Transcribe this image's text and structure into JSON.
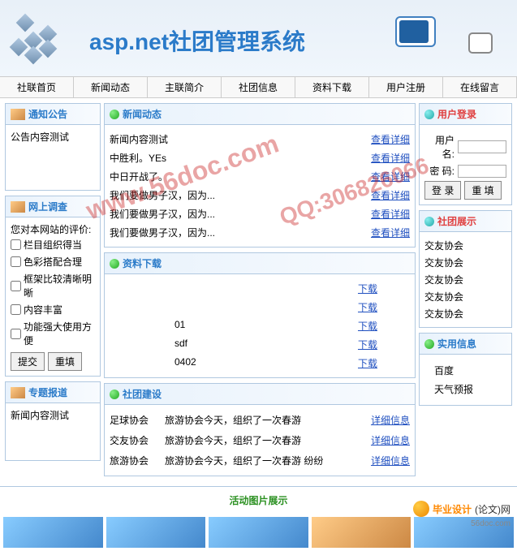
{
  "header": {
    "title": "asp.net社团管理系统"
  },
  "nav": [
    "社联首页",
    "新闻动态",
    "主联简介",
    "社团信息",
    "资料下载",
    "用户注册",
    "在线留言"
  ],
  "left": {
    "notice": {
      "title": "通知公告",
      "content": "公告内容测试"
    },
    "survey": {
      "title": "网上调查",
      "question": "您对本网站的评价:",
      "options": [
        "栏目组织得当",
        "色彩搭配合理",
        "框架比较清晰明晰",
        "内容丰富",
        "功能强大使用方便"
      ],
      "submit": "提交",
      "reset": "重填"
    },
    "special": {
      "title": "专题报道",
      "content": "新闻内容测试"
    }
  },
  "mid": {
    "news": {
      "title": "新闻动态",
      "items": [
        {
          "t": "新闻内容测试",
          "a": "查看详细"
        },
        {
          "t": "中胜利。YEs",
          "a": "查看详细"
        },
        {
          "t": "中日开战了。",
          "a": "查看详细"
        },
        {
          "t": "我们要做男子汉，因为...",
          "a": "查看详细"
        },
        {
          "t": "我们要做男子汉，因为...",
          "a": "查看详细"
        },
        {
          "t": "我们要做男子汉，因为...",
          "a": "查看详细"
        }
      ]
    },
    "download": {
      "title": "资料下载",
      "items": [
        {
          "t": "",
          "a": "下载"
        },
        {
          "t": "",
          "a": "下载"
        },
        {
          "t": "01",
          "a": "下载"
        },
        {
          "t": "sdf",
          "a": "下载"
        },
        {
          "t": "0402",
          "a": "下载"
        }
      ]
    },
    "club": {
      "title": "社团建设",
      "items": [
        {
          "n": "足球协会",
          "d": "旅游协会今天，组织了一次春游",
          "a": "详细信息"
        },
        {
          "n": "交友协会",
          "d": "旅游协会今天，组织了一次春游",
          "a": "详细信息"
        },
        {
          "n": "旅游协会",
          "d": "旅游协会今天，组织了一次春游 纷纷",
          "a": "详细信息"
        }
      ]
    },
    "gallery_title": "活动图片展示"
  },
  "right": {
    "login": {
      "title": "用户登录",
      "user_label": "用户名:",
      "pass_label": "密 码:",
      "login_btn": "登 录",
      "reset_btn": "重 填"
    },
    "show": {
      "title": "社团展示",
      "items": [
        "交友协会",
        "交友协会",
        "交友协会",
        "交友协会",
        "交友协会"
      ]
    },
    "info": {
      "title": "实用信息",
      "items": [
        "百度",
        "天气预报"
      ]
    }
  },
  "footer": {
    "brand1": "毕业设计",
    "brand2": "(论文)网",
    "url": "56doc.com"
  },
  "watermark": {
    "w1": "www.56doc.com",
    "w2": "QQ:306826066"
  }
}
